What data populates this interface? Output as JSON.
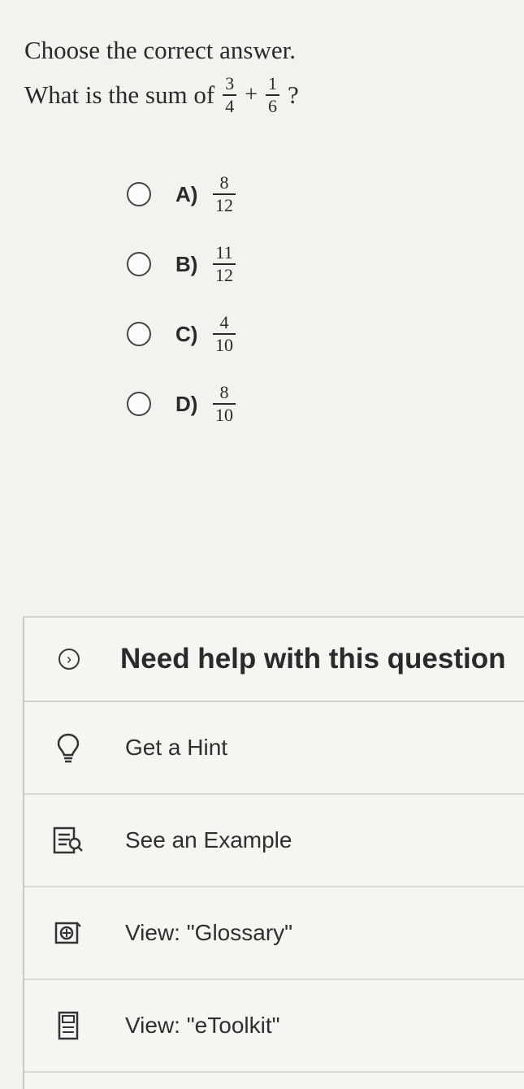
{
  "instructions": "Choose the correct answer.",
  "question": {
    "prefix": "What is the sum of",
    "frac1": {
      "num": "3",
      "den": "4"
    },
    "operator": "+",
    "frac2": {
      "num": "1",
      "den": "6"
    },
    "suffix": "?"
  },
  "options": [
    {
      "letter": "A)",
      "num": "8",
      "den": "12"
    },
    {
      "letter": "B)",
      "num": "11",
      "den": "12"
    },
    {
      "letter": "C)",
      "num": "4",
      "den": "10"
    },
    {
      "letter": "D)",
      "num": "8",
      "den": "10"
    }
  ],
  "help": {
    "title": "Need help with this question",
    "chevron": "›",
    "items": [
      {
        "label": "Get a Hint",
        "icon": "lightbulb-icon"
      },
      {
        "label": "See an Example",
        "icon": "example-icon"
      },
      {
        "label": "View: \"Glossary\"",
        "icon": "glossary-icon"
      },
      {
        "label": "View: \"eToolkit\"",
        "icon": "etoolkit-icon"
      }
    ]
  }
}
